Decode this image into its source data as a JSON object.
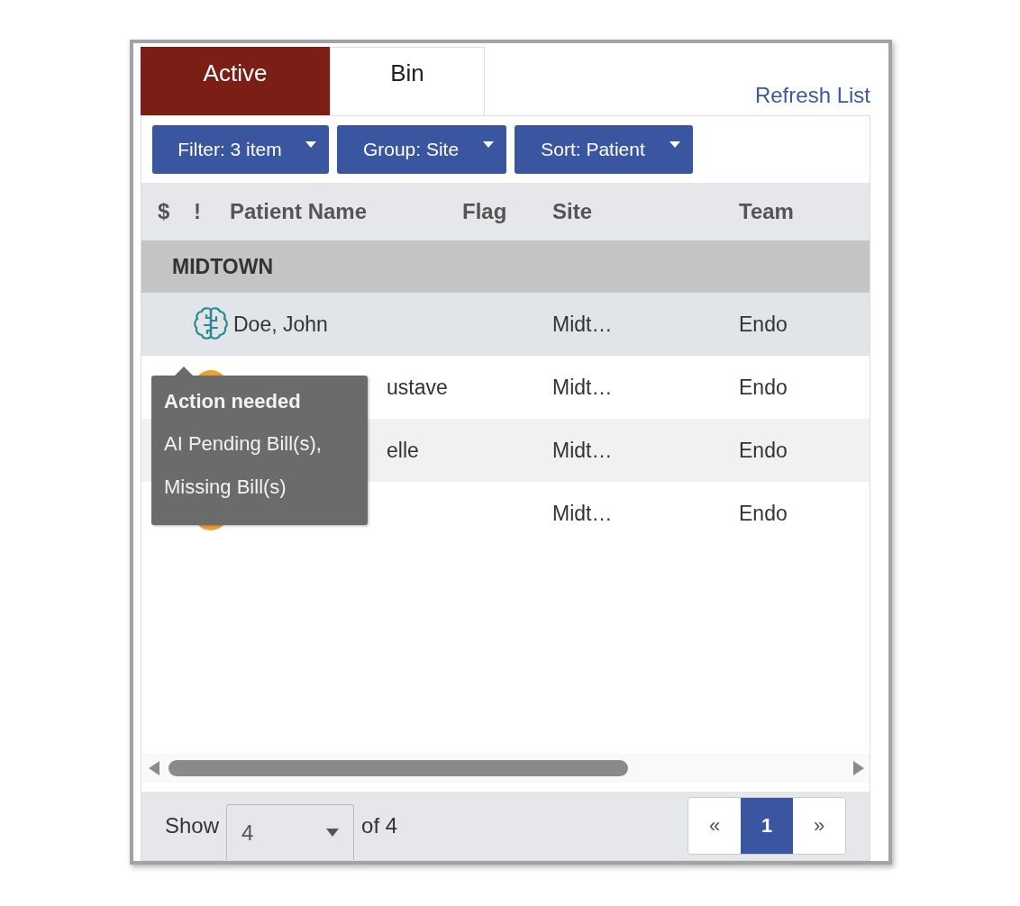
{
  "tabs": [
    {
      "label": "Active",
      "selected": true
    },
    {
      "label": "Bin",
      "selected": false
    }
  ],
  "refresh_link": "Refresh List",
  "toolbar": [
    "Filter: 3 item",
    "Group: Site",
    "Sort: Patient"
  ],
  "columns": [
    "$",
    "!",
    "Patient Name",
    "Flag",
    "Site",
    "Team"
  ],
  "group": "MIDTOWN",
  "rows": [
    {
      "kind": "brain",
      "name": "Doe, John",
      "covered": false,
      "site": "Midt…",
      "team": "Endo",
      "selected": true
    },
    {
      "kind": "alert",
      "name": "ustave",
      "covered": true,
      "site": "Midt…",
      "team": "Endo",
      "selected": false
    },
    {
      "kind": "plain",
      "name": "elle",
      "covered": true,
      "site": "Midt…",
      "team": "Endo",
      "selected": false
    },
    {
      "kind": "alert",
      "site": "Midt…",
      "team": "Endo",
      "selected": false
    }
  ],
  "tooltip": {
    "title": "Action needed",
    "lines": [
      "AI Pending Bill(s),",
      "Missing Bill(s)"
    ]
  },
  "footer": {
    "show_label": "Show",
    "page_size": "4",
    "of_label": "of 4",
    "prev": "«",
    "pages": [
      {
        "label": "1",
        "selected": true
      }
    ],
    "next": "»"
  }
}
